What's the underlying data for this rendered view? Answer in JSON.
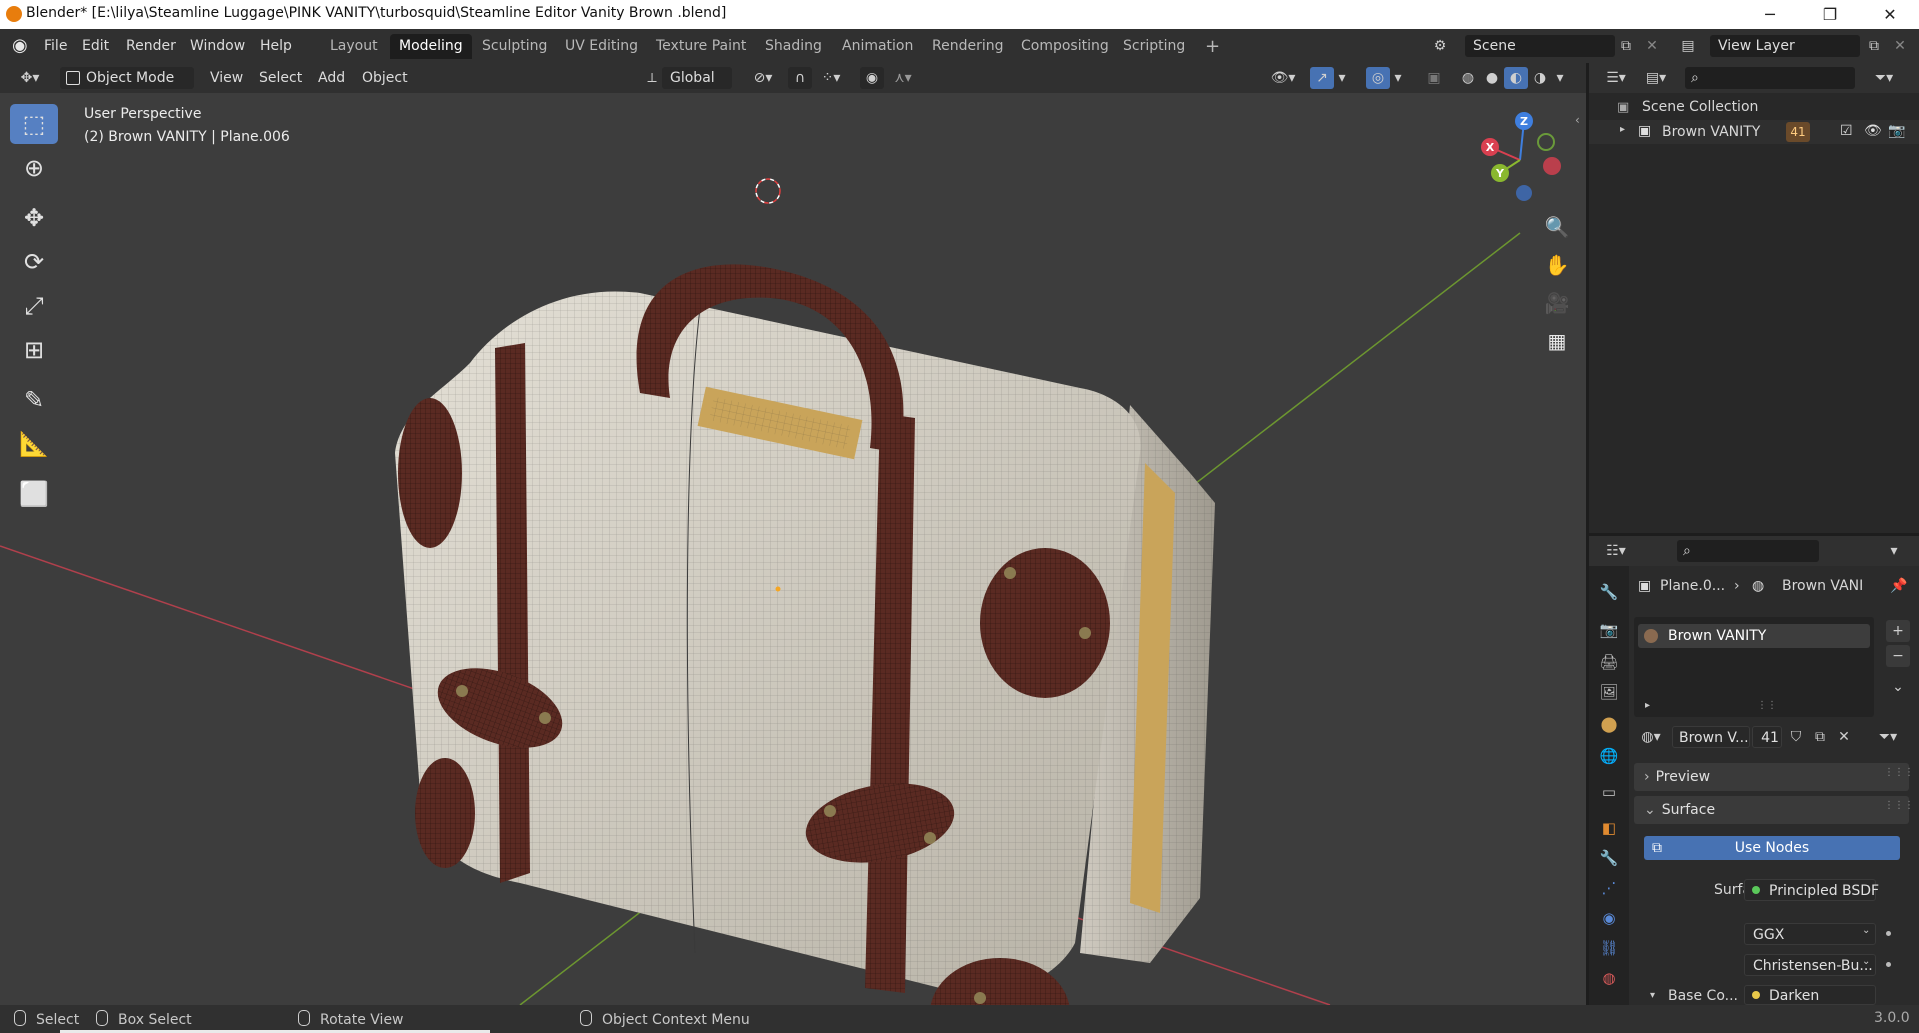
{
  "window": {
    "title": "Blender* [E:\\lilya\\Steamline Luggage\\PINK VANITY\\turbosquid\\Steamline Editor  Vanity Brown .blend]",
    "minimize_glyph": "─",
    "restore_glyph": "❐",
    "close_glyph": "✕"
  },
  "menubar": {
    "blender_glyph": "◉",
    "menus": [
      "File",
      "Edit",
      "Render",
      "Window",
      "Help"
    ],
    "workspaces": [
      "Layout",
      "Modeling",
      "Sculpting",
      "UV Editing",
      "Texture Paint",
      "Shading",
      "Animation",
      "Rendering",
      "Compositing",
      "Scripting"
    ],
    "active_workspace": "Modeling",
    "add_workspace": "+",
    "scene_label": "Scene",
    "view_layer_label": "View Layer"
  },
  "viewport_header": {
    "mode": "Object Mode",
    "menus": [
      "View",
      "Select",
      "Add",
      "Object"
    ],
    "orientation": "Global"
  },
  "viewport": {
    "perspective_label": "User Perspective",
    "object_label": "(2) Brown VANITY | Plane.006",
    "gizmo": {
      "x": "X",
      "y": "Y",
      "z": "Z"
    }
  },
  "outliner": {
    "collection": "Scene Collection",
    "item": "Brown VANITY",
    "item_count": "41"
  },
  "properties": {
    "breadcrumb_object": "Plane.0...",
    "breadcrumb_material": "Brown VANI",
    "material_slot": "Brown VANITY",
    "material_name": "Brown V...",
    "material_users": "41",
    "panels": {
      "preview": "Preview",
      "surface": "Surface"
    },
    "use_nodes": "Use Nodes",
    "surface_label": "Surface",
    "surface_value": "Principled BSDF",
    "distribution": "GGX",
    "subsurface_method": "Christensen-Bu...",
    "base_color_label": "Base Co...",
    "base_color_value": "Darken"
  },
  "statusbar": {
    "select": "Select",
    "box_select": "Box Select",
    "rotate_view": "Rotate View",
    "context_menu": "Object Context Menu",
    "version": "3.0.0"
  },
  "colors": {
    "accent": "#4772b3",
    "active_tool": "#5680c2",
    "axis_x": "#d94050",
    "axis_y": "#8ab82f",
    "axis_z": "#3f7fdf",
    "leather": "#5a2a22",
    "case_body": "#c8c4ba",
    "brass": "#c9a45a"
  }
}
